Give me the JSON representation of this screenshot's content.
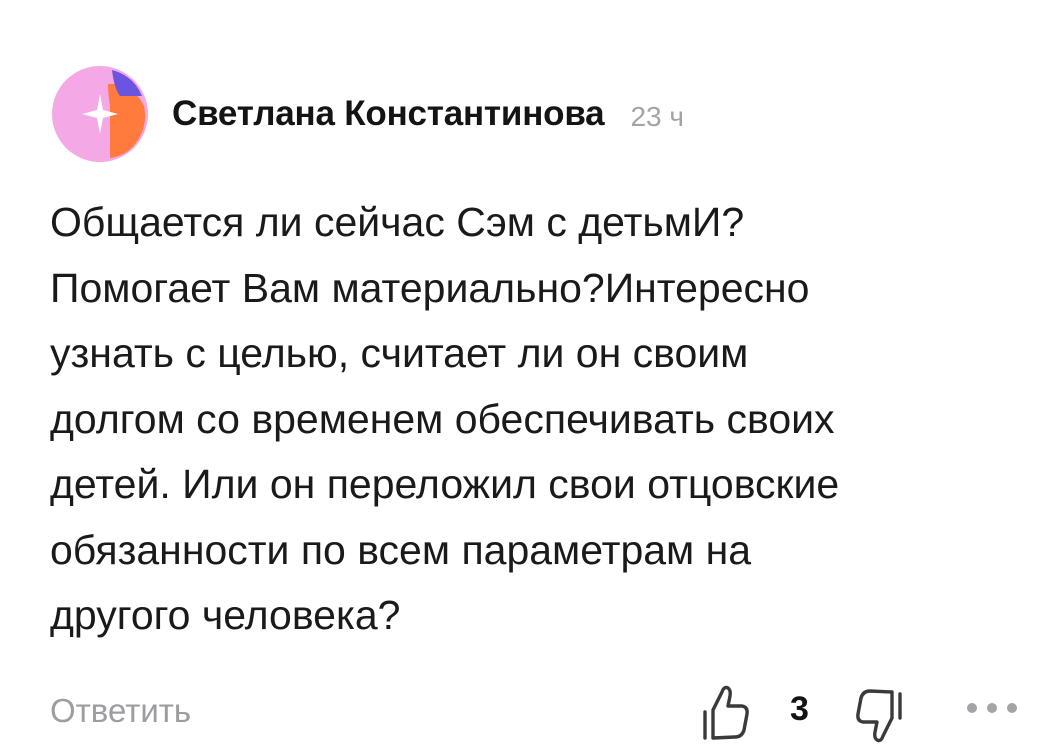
{
  "comment": {
    "author": "Светлана Константинова",
    "time": "23 ч",
    "text": "Общается ли сейчас Сэм с детьмИ?\nПомогает Вам материально?Интересно\nузнать с целью, считает ли он своим\nдолгом со временем обеспечивать своих\nдетей. Или он переложил свои отцовские\nобязанности по всем параметрам на\nдругого человека?",
    "avatar_colors": [
      "#f4a8e6",
      "#ff7a3d",
      "#6b55e0"
    ]
  },
  "actions": {
    "reply_label": "Ответить",
    "like_icon": "thumbs-up-icon",
    "like_count": "3",
    "dislike_icon": "thumbs-down-icon",
    "more_icon": "more-dots-icon"
  }
}
